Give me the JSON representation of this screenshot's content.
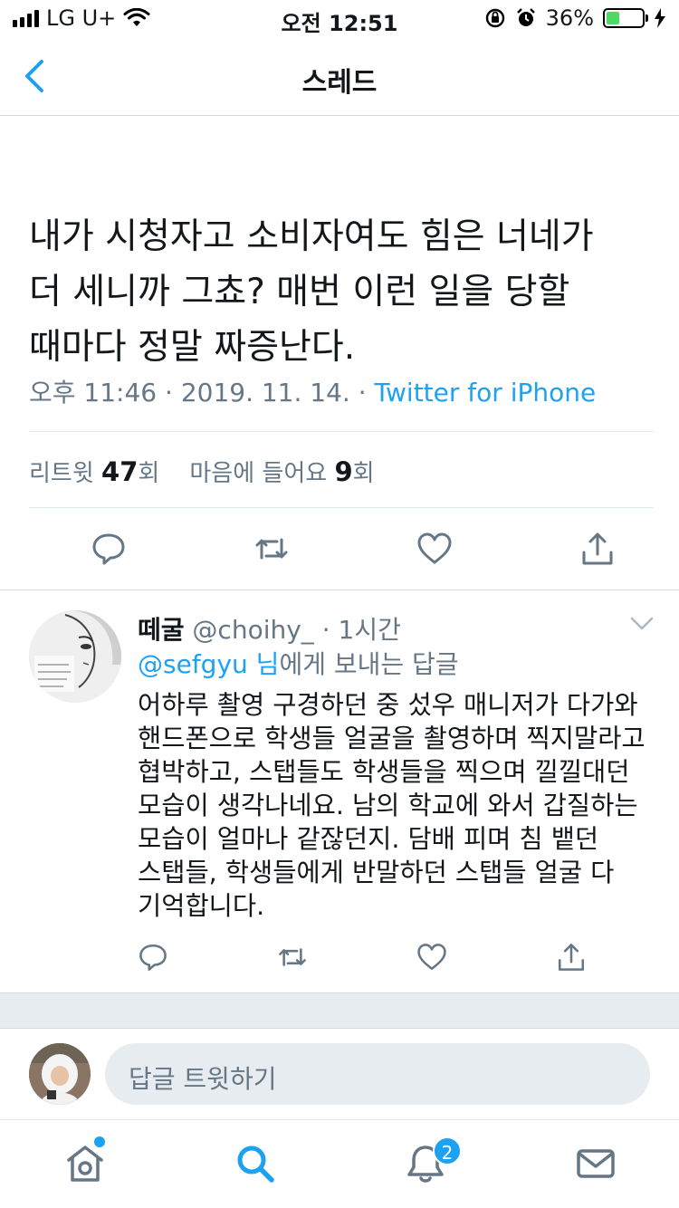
{
  "status_bar": {
    "carrier": "LG U+",
    "time": "오전 12:51",
    "battery": "36%",
    "battery_level": 0.36
  },
  "nav": {
    "title": "스레드"
  },
  "main_tweet": {
    "text": "내가 시청자고 소비자여도 힘은 너네가\n더 세니까 그쵸? 매번 이런 일을 당할\n때마다 정말 짜증난다.",
    "time": "오후 11:46 · 2019. 11. 14. · ",
    "source": "Twitter for iPhone",
    "retweet_label": "리트윗 ",
    "retweet_count": "47",
    "retweet_suffix": "회",
    "like_label": "마음에 들어요 ",
    "like_count": "9",
    "like_suffix": "회"
  },
  "reply": {
    "name": "떼굴",
    "handle": " @choihy_",
    "time": " · 1시간",
    "reply_to_mention": "@sefgyu 님",
    "reply_to_suffix": "에게 보내는 답글",
    "text": "어하루 촬영 구경하던 중 섰우 매니저가 다가와\n핸드폰으로 학생들 얼굴을 촬영하며 찍지말라고\n협박하고, 스탭들도 학생들을 찍으며 낄낄대던\n모습이 생각나네요. 남의 학교에 와서 갑질하는\n모습이 얼마나 같잖던지. 담배 피며 침 뱉던\n스탭들, 학생들에게 반말하던 스탭들 얼굴 다\n기억합니다."
  },
  "compose": {
    "placeholder": "답글 트윗하기"
  },
  "tabs": {
    "notifications_badge": "2"
  },
  "colors": {
    "accent": "#1da1f2",
    "secondary_text": "#657786",
    "band": "#e6ecf0"
  }
}
